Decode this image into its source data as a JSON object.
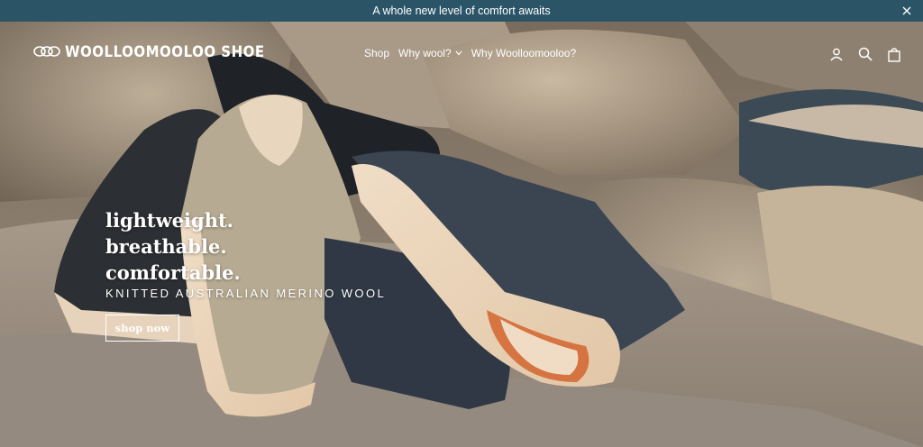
{
  "announcement": {
    "text": "A whole new level of comfort awaits"
  },
  "header": {
    "logo_text": "WOOLLOOMOOLOO SHOE",
    "nav": [
      {
        "label": "Shop"
      },
      {
        "label": "Why wool?"
      },
      {
        "label": "Why Woolloomooloo?"
      }
    ]
  },
  "hero": {
    "headline_lines": [
      "lightweight.",
      "breathable.",
      "comfortable."
    ],
    "subheading": "KNITTED AUSTRALIAN MERINO WOOL",
    "cta_label": "shop now"
  },
  "colors": {
    "announcement_bg": "#2b5467",
    "text_on_hero": "#ffffff"
  },
  "icons": [
    "close-icon",
    "chevron-down-icon",
    "account-icon",
    "search-icon",
    "cart-icon"
  ]
}
